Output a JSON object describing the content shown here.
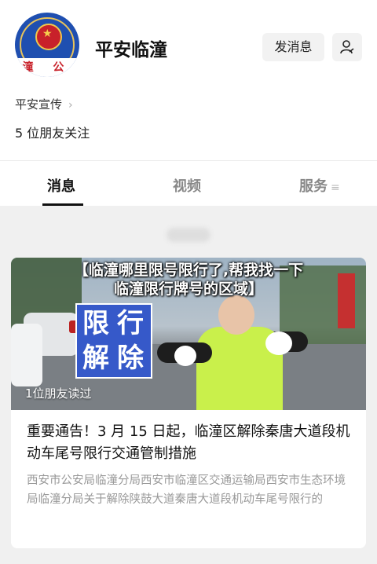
{
  "account": {
    "name": "平安临潼",
    "avatar_text": "潼 公",
    "message_button": "发消息"
  },
  "profile": {
    "promo_link": "平安宣传",
    "friends_following": "5 位朋友关注"
  },
  "tabs": [
    {
      "label": "消息",
      "active": true
    },
    {
      "label": "视频",
      "active": false
    },
    {
      "label": "服务",
      "active": false
    }
  ],
  "overlay": {
    "line1": "【临潼哪里限号限行了,帮我找一下",
    "line2": "临潼限行牌号的区域】"
  },
  "article": {
    "cover_sign": [
      "限",
      "行",
      "解",
      "除"
    ],
    "read_count": "1位朋友读过",
    "headline": "重要通告！3 月 15 日起，临潼区解除秦唐大道段机动车尾号限行交通管制措施",
    "summary": "西安市公安局临潼分局西安市临潼区交通运输局西安市生态环境局临潼分局关于解除陕鼓大道秦唐大道段机动车尾号限行的"
  },
  "colors": {
    "sign_blue": "#3659c9",
    "vest_yellow": "#c9f04b",
    "avatar_blue": "#1f4fb0"
  }
}
